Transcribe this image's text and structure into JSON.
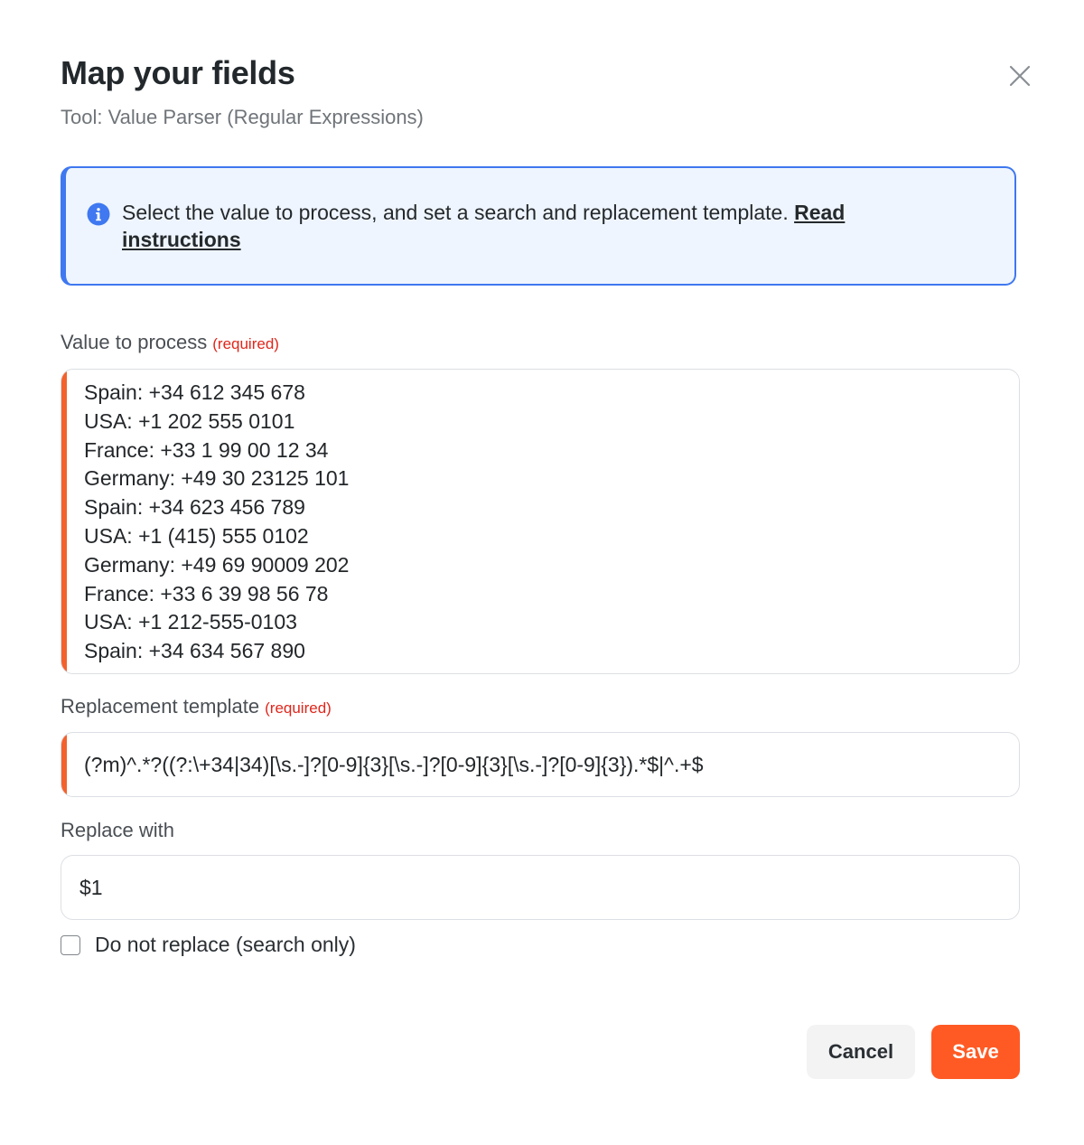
{
  "dialog": {
    "title": "Map your fields",
    "subtitle": "Tool: Value Parser (Regular Expressions)",
    "close_icon": "close-icon"
  },
  "info": {
    "icon": "info-icon",
    "text": "Select the value to process, and set a search and replacement template. ",
    "link_text": "Read instructions",
    "accent_color": "#3f78f0"
  },
  "fields": {
    "value_to_process": {
      "label": "Value to process",
      "required_text": "(required)",
      "lines": [
        "Spain: +34 612 345 678",
        "USA: +1 202 555 0101",
        "France: +33 1 99 00 12 34",
        "Germany: +49 30 23125 101",
        "Spain: +34 623 456 789",
        "USA: +1 (415) 555 0102",
        "Germany: +49 69 90009 202",
        "France: +33 6 39 98 56 78",
        "USA: +1 212-555-0103",
        "Spain: +34 634 567 890"
      ]
    },
    "replacement_template": {
      "label": "Replacement template",
      "required_text": "(required)",
      "value": "(?m)^.*?((?:\\+34|34)[\\s.-]?[0-9]{3}[\\s.-]?[0-9]{3}[\\s.-]?[0-9]{3}).*$|^.+$"
    },
    "replace_with": {
      "label": "Replace with",
      "value": "$1"
    },
    "search_only": {
      "label": "Do not replace (search only)",
      "checked": false
    }
  },
  "actions": {
    "cancel_label": "Cancel",
    "save_label": "Save",
    "save_color": "#ff5a24"
  }
}
